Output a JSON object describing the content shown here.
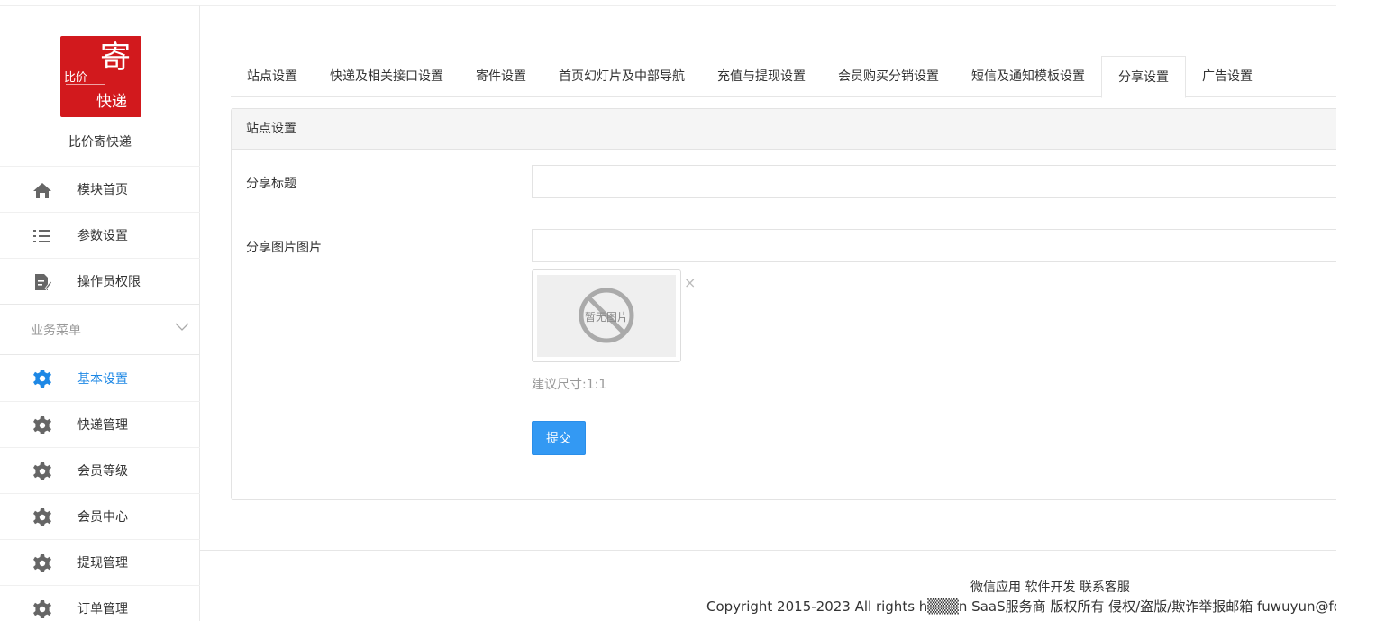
{
  "brand": {
    "logo_text_small": "比价",
    "logo_text_big": "寄",
    "logo_text_bottom": "快递",
    "name": "比价寄快递"
  },
  "sidebar": {
    "top_items": [
      {
        "label": "模块首页",
        "icon": "home-icon"
      },
      {
        "label": "参数设置",
        "icon": "list-icon"
      },
      {
        "label": "操作员权限",
        "icon": "document-edit-icon"
      }
    ],
    "section": {
      "label": "业务菜单",
      "icon": "chevron-down-icon"
    },
    "business_items": [
      {
        "label": "基本设置",
        "icon": "gear-icon",
        "active": true
      },
      {
        "label": "快递管理",
        "icon": "gear-icon"
      },
      {
        "label": "会员等级",
        "icon": "gear-icon"
      },
      {
        "label": "会员中心",
        "icon": "gear-icon"
      },
      {
        "label": "提现管理",
        "icon": "gear-icon"
      },
      {
        "label": "订单管理",
        "icon": "gear-icon"
      }
    ]
  },
  "tabs": [
    {
      "label": "站点设置"
    },
    {
      "label": "快递及相关接口设置"
    },
    {
      "label": "寄件设置"
    },
    {
      "label": "首页幻灯片及中部导航"
    },
    {
      "label": "充值与提现设置"
    },
    {
      "label": "会员购买分销设置"
    },
    {
      "label": "短信及通知模板设置"
    },
    {
      "label": "分享设置",
      "active": true
    },
    {
      "label": "广告设置"
    }
  ],
  "panel": {
    "title": "站点设置",
    "share_title_label": "分享标题",
    "share_title_value": "",
    "share_image_label": "分享图片图片",
    "share_image_value": "",
    "no_image_text": "暂无图片",
    "remove_symbol": "×",
    "size_hint": "建议尺寸:1:1",
    "submit_label": "提交"
  },
  "footer": {
    "links": "微信应用 软件开发 联系客服",
    "copyright": "Copyright 2015-2023 All rights h▒▒▒n SaaS服务商 版权所有 侵权/盗版/欺诈举报邮箱 fuwuyun@fo"
  },
  "colors": {
    "accent": "#1e88e5",
    "button": "#3399f3",
    "logo_bg": "#d2191d",
    "icon_gray": "#666666"
  }
}
